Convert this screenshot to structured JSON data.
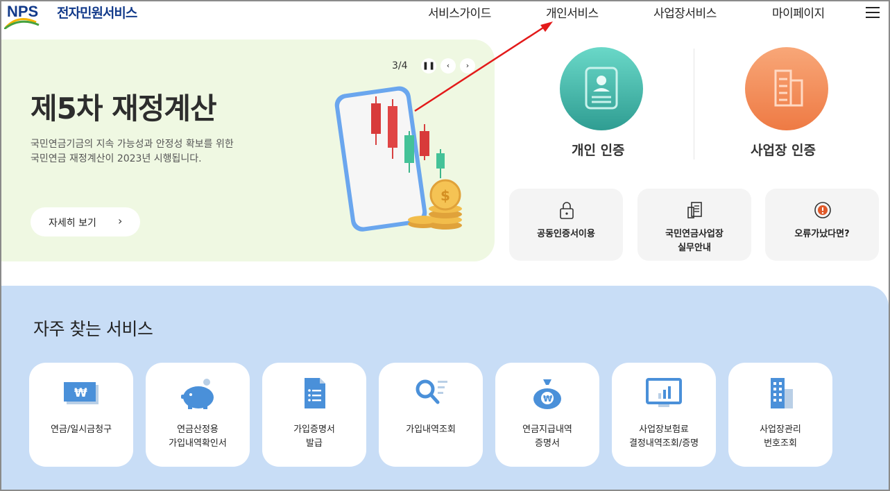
{
  "header": {
    "logo_mark": "NPS",
    "logo_text": "전자민원서비스",
    "nav": [
      {
        "label": "서비스가이드"
      },
      {
        "label": "개인서비스"
      },
      {
        "label": "사업장서비스"
      },
      {
        "label": "마이페이지"
      }
    ],
    "menu_icon": "hamburger-icon"
  },
  "hero": {
    "title": "제5차 재정계산",
    "desc_line1": "국민연금기금의 지속 가능성과 안정성 확보를 위한",
    "desc_line2": "국민연금 재정계산이 2023년 시행됩니다.",
    "detail_button": "자세히 보기",
    "pager": "3/4",
    "pause_icon": "pause-icon",
    "prev_icon": "chevron-left-icon",
    "next_icon": "chevron-right-icon"
  },
  "auth": {
    "personal_label": "개인 인증",
    "business_label": "사업장 인증",
    "personal_color": "#3cb3a8",
    "business_color": "#f3824e"
  },
  "quick_links": [
    {
      "line1": "공동인증서이용",
      "line2": "",
      "icon": "lock-icon"
    },
    {
      "line1": "국민연금사업장",
      "line2": "실무안내",
      "icon": "document-icon"
    },
    {
      "line1": "오류가났다면?",
      "line2": "",
      "icon": "alert-icon"
    }
  ],
  "services": {
    "title": "자주 찾는 서비스",
    "items": [
      {
        "line1": "연금/일시금청구",
        "line2": "",
        "icon": "won-bill-icon"
      },
      {
        "line1": "연금산정용",
        "line2": "가입내역확인서",
        "icon": "piggy-bank-icon"
      },
      {
        "line1": "가입증명서",
        "line2": "발급",
        "icon": "document-list-icon"
      },
      {
        "line1": "가입내역조회",
        "line2": "",
        "icon": "search-list-icon"
      },
      {
        "line1": "연금지급내역",
        "line2": "증명서",
        "icon": "money-bag-icon"
      },
      {
        "line1": "사업장보험료",
        "line2": "결정내역조회/증명",
        "icon": "monitor-chart-icon"
      },
      {
        "line1": "사업장관리",
        "line2": "번호조회",
        "icon": "building-icon"
      }
    ],
    "background": "#c8ddf6"
  },
  "annotation": {
    "color": "#e31a1a"
  }
}
